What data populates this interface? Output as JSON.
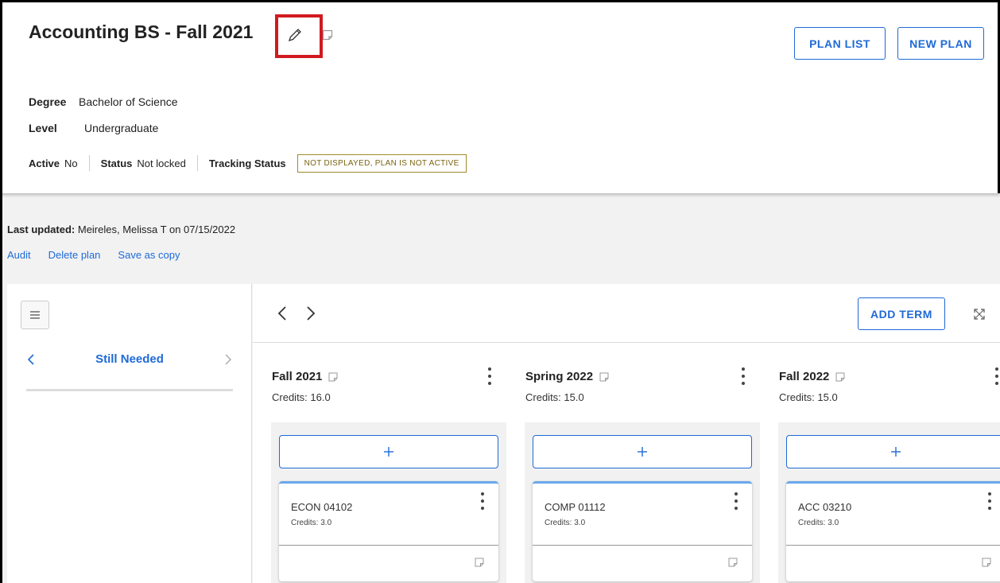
{
  "plan": {
    "title": "Accounting BS - Fall 2021",
    "degree_label": "Degree",
    "degree_value": "Bachelor of Science",
    "level_label": "Level",
    "level_value": "Undergraduate",
    "active_label": "Active",
    "active_value": "No",
    "status_label": "Status",
    "status_value": "Not locked",
    "tracking_label": "Tracking Status",
    "tracking_value": "NOT DISPLAYED, PLAN IS NOT ACTIVE"
  },
  "header_buttons": {
    "plan_list": "PLAN LIST",
    "new_plan": "NEW PLAN"
  },
  "meta": {
    "last_updated_label": "Last updated:",
    "last_updated_value": "Meireles, Melissa T on 07/15/2022",
    "links": [
      "Audit",
      "Delete plan",
      "Save as copy"
    ]
  },
  "sidebar": {
    "section": "Still Needed"
  },
  "toolbar": {
    "add_term": "ADD TERM"
  },
  "terms": [
    {
      "name": "Fall 2021",
      "credits": "Credits:  16.0",
      "course_code": "ECON 04102",
      "course_credits": "Credits: 3.0"
    },
    {
      "name": "Spring 2022",
      "credits": "Credits:  15.0",
      "course_code": "COMP 01112",
      "course_credits": "Credits: 3.0"
    },
    {
      "name": "Fall 2022",
      "credits": "Credits:  15.0",
      "course_code": "ACC 03210",
      "course_credits": "Credits: 3.0"
    }
  ],
  "colors": {
    "accent": "#1f6ad6",
    "highlight_box": "#d11a20",
    "tracking_badge": "#a08a2a"
  }
}
